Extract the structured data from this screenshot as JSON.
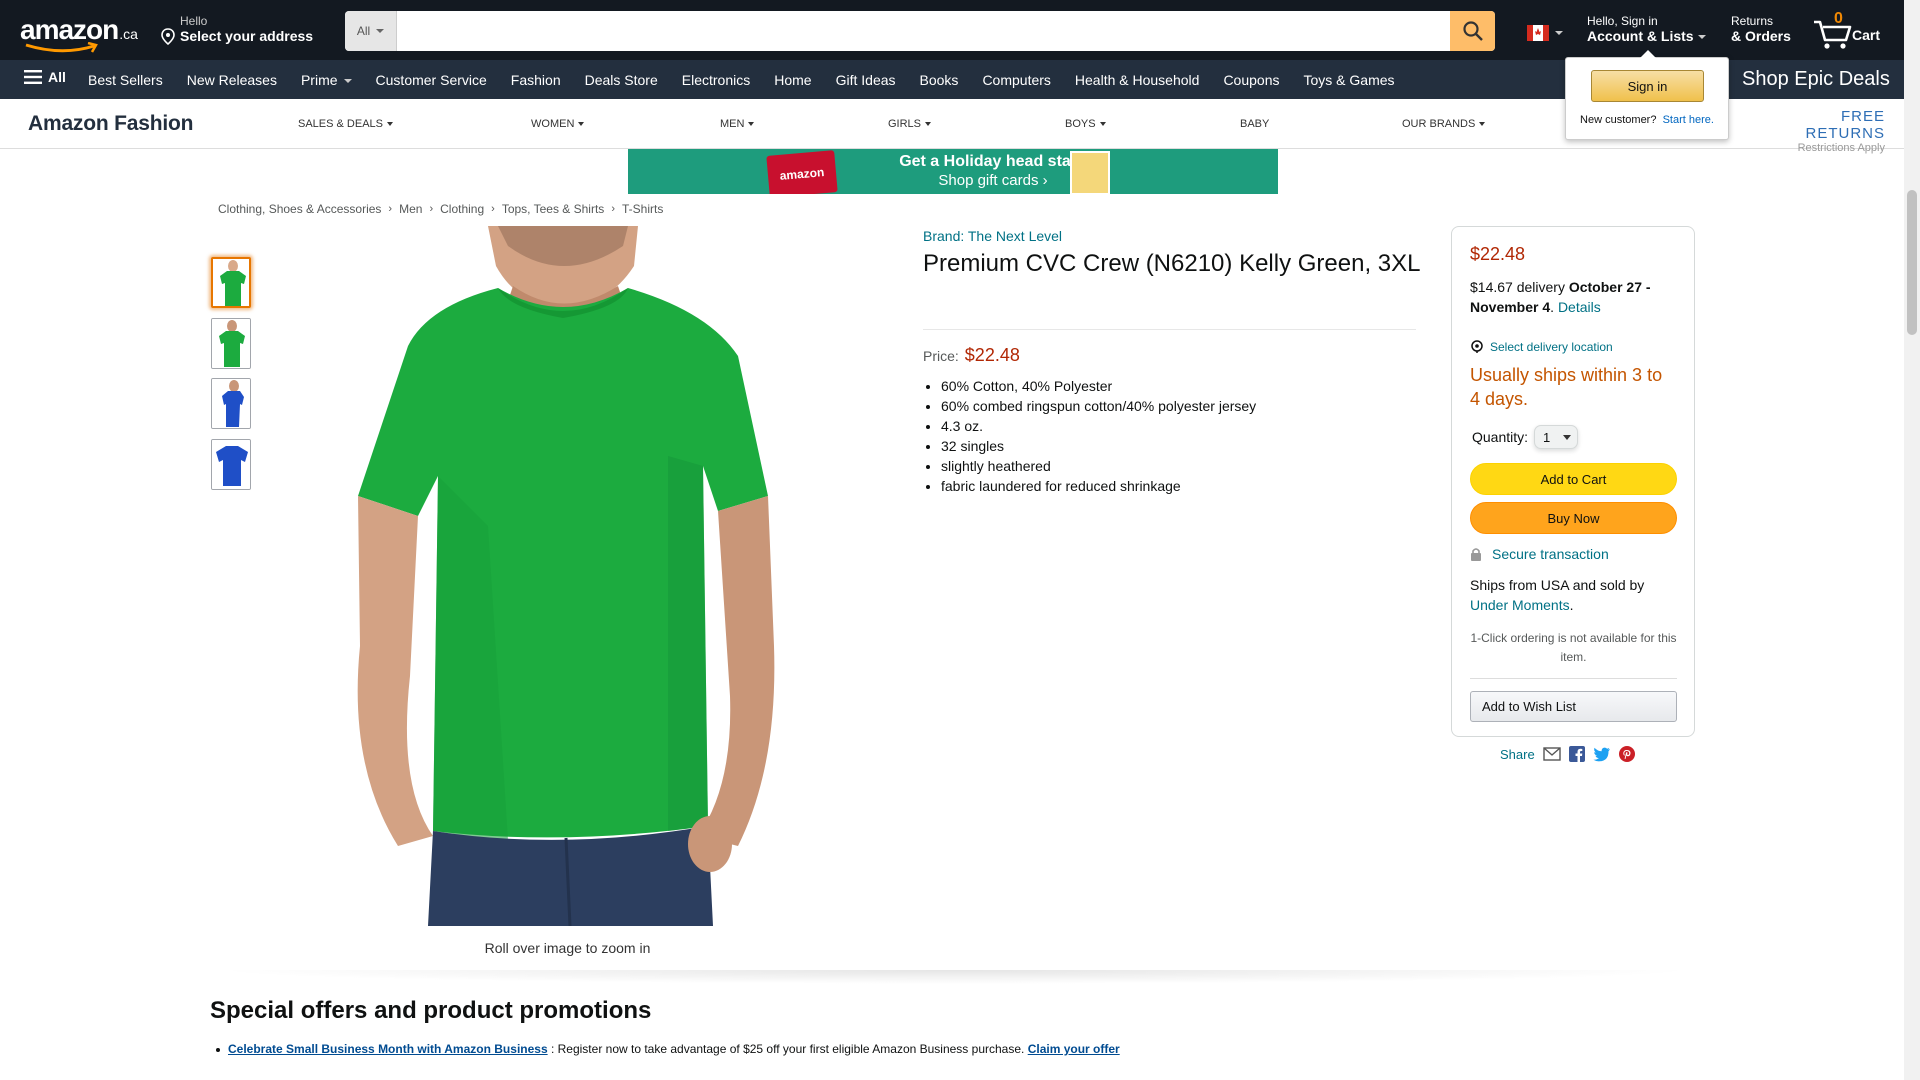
{
  "topnav": {
    "logo_word": "amazon",
    "logo_tld": ".ca",
    "deliver_line1": "Hello",
    "deliver_line2": "Select your address",
    "search_category": "All",
    "search_placeholder": "",
    "account_line1": "Hello, Sign in",
    "account_line2": "Account & Lists",
    "returns_line1": "Returns",
    "returns_line2": "& Orders",
    "cart_count": "0",
    "cart_label": "Cart",
    "flag": "canada-flag-icon"
  },
  "subnav": {
    "all_label": "All",
    "items": [
      {
        "label": "Best Sellers"
      },
      {
        "label": "New Releases"
      },
      {
        "label": "Prime",
        "dropdown": true
      },
      {
        "label": "Customer Service"
      },
      {
        "label": "Fashion"
      },
      {
        "label": "Deals Store"
      },
      {
        "label": "Electronics"
      },
      {
        "label": "Home"
      },
      {
        "label": "Gift Ideas"
      },
      {
        "label": "Books"
      },
      {
        "label": "Computers"
      },
      {
        "label": "Health & Household"
      },
      {
        "label": "Coupons"
      },
      {
        "label": "Toys & Games"
      }
    ],
    "epic_deals": "Shop Epic Deals"
  },
  "signin_flyout": {
    "button": "Sign in",
    "new_customer": "New customer?",
    "start_here": "Start here."
  },
  "fashion": {
    "logo": "Amazon Fashion",
    "categories": [
      {
        "label": "SALES & DEALS",
        "dropdown": true
      },
      {
        "label": "WOMEN",
        "dropdown": true
      },
      {
        "label": "MEN",
        "dropdown": true
      },
      {
        "label": "GIRLS",
        "dropdown": true
      },
      {
        "label": "BOYS",
        "dropdown": true
      },
      {
        "label": "BABY",
        "dropdown": false
      },
      {
        "label": "OUR BRANDS",
        "dropdown": true
      }
    ],
    "free_returns": "FREE RETURNS",
    "restrictions": "Restrictions Apply"
  },
  "banner": {
    "tag": "amazon",
    "line1": "Get a Holiday head start.",
    "line2": "Shop gift cards ›"
  },
  "breadcrumb": [
    "Clothing, Shoes & Accessories",
    "Men",
    "Clothing",
    "Tops, Tees & Shirts",
    "T-Shirts"
  ],
  "product": {
    "brand": "Brand: The Next Level",
    "title": "Premium CVC Crew (N6210) Kelly Green, 3XL",
    "price_label": "Price:",
    "price": "$22.48",
    "bullets": [
      "60% Cotton, 40% Polyester",
      "60% combed ringspun cotton/40% polyester jersey",
      "4.3 oz.",
      "32 singles",
      "slightly heathered",
      "fabric laundered for reduced shrinkage"
    ],
    "zoom_hint": "Roll over image to zoom in",
    "thumbnails": [
      {
        "color": "#1cab3f",
        "selected": true
      },
      {
        "color": "#1cab3f",
        "selected": false
      },
      {
        "color": "#1f4fc7",
        "selected": false
      },
      {
        "color": "#1f4fc7",
        "selected": false
      }
    ],
    "shirt_color": "#1cab3f"
  },
  "buybox": {
    "price": "$22.48",
    "delivery_cost": "$14.67 delivery",
    "delivery_dates": "October 27 - November 4",
    "delivery_details": "Details",
    "location": "Select delivery location",
    "ships_within": "Usually ships within 3 to 4 days.",
    "quantity_label": "Quantity:",
    "quantity_value": "1",
    "add_to_cart": "Add to Cart",
    "buy_now": "Buy Now",
    "secure": "Secure transaction",
    "ships_from": "Ships from USA and sold by",
    "seller": "Under Moments",
    "one_click": "1-Click ordering is not available for this item.",
    "wish_list": "Add to Wish List"
  },
  "share": {
    "label": "Share"
  },
  "promotions": {
    "heading": "Special offers and product promotions",
    "offer_link": "Celebrate Small Business Month with Amazon Business",
    "offer_text": " : Register now to take advantage of $25 off your first eligible Amazon Business purchase. ",
    "claim": "Claim your offer"
  },
  "colors": {
    "nav_dark": "#131921",
    "nav_sub": "#232f3e",
    "price_red": "#b12704",
    "link_teal": "#007185",
    "add_to_cart_yellow": "#ffd814",
    "buy_now_orange": "#ffa41c",
    "ships_orange": "#c45500"
  }
}
